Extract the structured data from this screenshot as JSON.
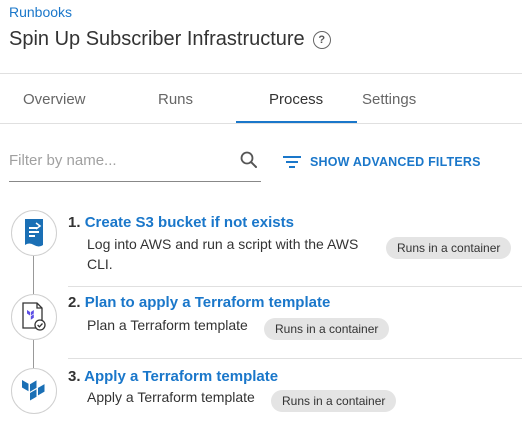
{
  "breadcrumb": "Runbooks",
  "page_title": "Spin Up Subscriber Infrastructure",
  "help_glyph": "?",
  "tabs": [
    {
      "label": "Overview"
    },
    {
      "label": "Runs"
    },
    {
      "label": "Process",
      "active": true
    },
    {
      "label": "Settings"
    }
  ],
  "filter": {
    "placeholder": "Filter by name...",
    "value": ""
  },
  "advanced_filters_label": "SHOW ADVANCED FILTERS",
  "steps": [
    {
      "number": "1.",
      "title": "Create S3 bucket if not exists",
      "description": "Log into AWS and run a script with the AWS CLI.",
      "badge": "Runs in a container",
      "icon": "aws-cli-icon"
    },
    {
      "number": "2.",
      "title": "Plan to apply a Terraform template",
      "description": "Plan a Terraform template",
      "badge": "Runs in a container",
      "icon": "terraform-plan-icon"
    },
    {
      "number": "3.",
      "title": "Apply a Terraform template",
      "description": "Apply a Terraform template",
      "badge": "Runs in a container",
      "icon": "terraform-icon"
    }
  ],
  "colors": {
    "accent": "#1a77ca",
    "terraform": "#5c4ee5"
  }
}
